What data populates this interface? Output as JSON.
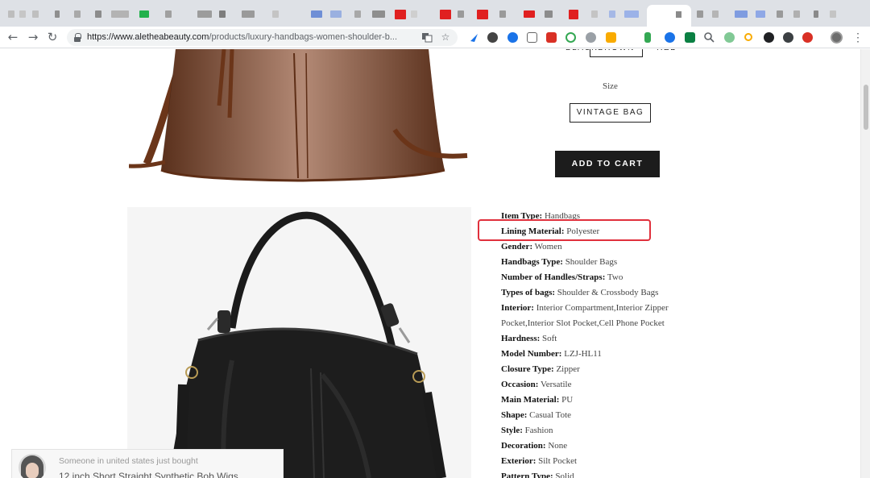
{
  "browser": {
    "url_host": "https://www.aletheabeauty.com",
    "url_path": "/products/luxury-handbags-women-shoulder-b...",
    "nav": {
      "back": "←",
      "forward": "→",
      "reload": "↻"
    },
    "icons": [
      "translate-icon",
      "bookmark-star-icon",
      "menu-dots-icon"
    ]
  },
  "product": {
    "colors": [
      "BLACK",
      "BROWN",
      "RED"
    ],
    "selected_color": "BROWN",
    "size_label": "Size",
    "size_option": "VINTAGE BAG",
    "add_to_cart": "ADD TO CART",
    "specs": [
      {
        "key": "Item Type:",
        "value": " Handbags"
      },
      {
        "key": "Lining Material:",
        "value": " Polyester"
      },
      {
        "key": "Gender:",
        "value": " Women"
      },
      {
        "key": "Handbags Type:",
        "value": " Shoulder Bags"
      },
      {
        "key": "Number of Handles/Straps:",
        "value": " Two"
      },
      {
        "key": "Types of bags:",
        "value": " Shoulder & Crossbody Bags"
      },
      {
        "key": "Interior:",
        "value": " Interior Compartment,Interior Zipper"
      },
      {
        "key": "",
        "value": "Pocket,Interior Slot Pocket,Cell Phone Pocket"
      },
      {
        "key": "Hardness:",
        "value": " Soft"
      },
      {
        "key": "Model Number:",
        "value": " LZJ-HL11"
      },
      {
        "key": "Closure Type:",
        "value": " Zipper"
      },
      {
        "key": "Occasion:",
        "value": " Versatile"
      },
      {
        "key": "Main Material:",
        "value": " PU"
      },
      {
        "key": "Shape:",
        "value": " Casual Tote"
      },
      {
        "key": "Style:",
        "value": " Fashion"
      },
      {
        "key": "Decoration:",
        "value": " None"
      },
      {
        "key": "Exterior:",
        "value": " Silt Pocket"
      },
      {
        "key": "Pattern Type:",
        "value": " Solid"
      }
    ]
  },
  "toast": {
    "line1": "Someone in united states just bought",
    "line2": "12 inch Short Straight Synthetic Bob Wigs"
  },
  "colors": {
    "highlight": "#e0303c",
    "button_bg": "#1c1c1c",
    "leather_brown": "#8a4a2b",
    "leather_black": "#1a1a1a"
  }
}
